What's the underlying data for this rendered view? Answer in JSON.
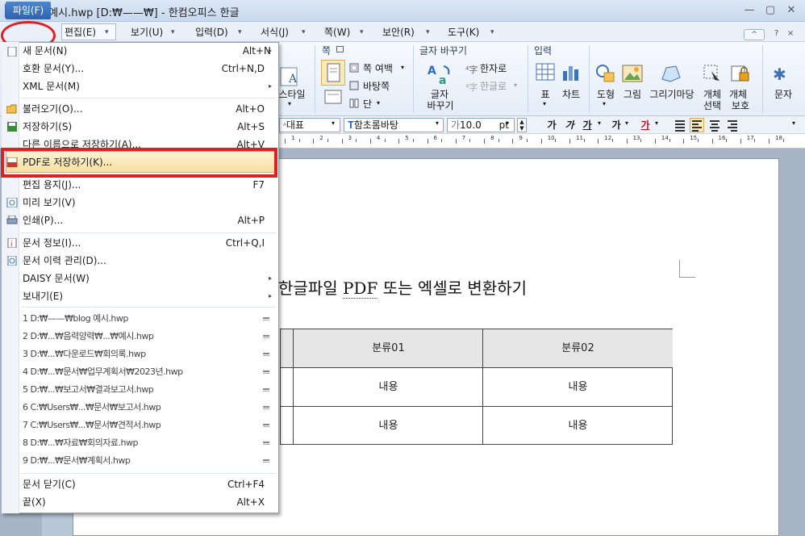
{
  "window": {
    "title": "blog 예시.hwp [D:₩——₩] - 한컴오피스 한글",
    "controls": {
      "minimize": "—",
      "restore": "▢",
      "close": "✕"
    }
  },
  "menubar": {
    "items": [
      "파일(F)",
      "편집(E)",
      "보기(U)",
      "입력(D)",
      "서식(J)",
      "쪽(W)",
      "보안(R)",
      "도구(K)"
    ],
    "help_items": [
      "^",
      "?",
      "×"
    ]
  },
  "ribbon": {
    "groups": {
      "page": "쪽",
      "char_convert": "글자 바꾸기",
      "input": "입력"
    },
    "buttons": {
      "style": "스타일",
      "page_margin": "쪽 여백",
      "background": "바탕쪽",
      "column": "단",
      "change_char": "글자\n바꾸기",
      "change_char_1": "글자",
      "change_char_2": "바꾸기",
      "hanja": "한자로",
      "hangul": "한글로",
      "table": "표",
      "chart": "차트",
      "shape": "도형",
      "picture": "그림",
      "drawing_mart": "그리기마당",
      "object_select_1": "개체",
      "object_select_2": "선택",
      "object_protect_1": "개체",
      "object_protect_2": "보호",
      "char_1": "문자"
    }
  },
  "format_bar": {
    "style": "대표",
    "font": "함초롬바탕",
    "size": "10.0",
    "unit": "pt",
    "bold": "가",
    "italic": "가",
    "underline": "가",
    "char_shape": "가",
    "color_text": "가"
  },
  "ruler": {
    "numbers": [
      "1",
      "2",
      "3",
      "4",
      "5",
      "6",
      "7",
      "8",
      "9",
      "10",
      "11",
      "12",
      "13",
      "14",
      "15",
      "16",
      "17",
      "18"
    ]
  },
  "document": {
    "title_pre": "한글파일 ",
    "title_pdf": "PDF",
    "title_post": " 또는 엑셀로 변환하기",
    "table": {
      "headers": [
        "분류01",
        "분류02"
      ],
      "rows": [
        [
          "내용",
          "내용"
        ],
        [
          "내용",
          "내용"
        ]
      ]
    }
  },
  "file_menu": {
    "items": [
      {
        "label": "새 문서(N)",
        "shortcut": "Alt+N",
        "arrow": "▸"
      },
      {
        "label": "호환 문서(Y)...",
        "shortcut": "Ctrl+N,D",
        "arrow": ""
      },
      {
        "label": "XML 문서(M)",
        "shortcut": "",
        "arrow": "▸"
      },
      {
        "label": "불러오기(O)...",
        "shortcut": "Alt+O",
        "arrow": ""
      },
      {
        "label": "저장하기(S)",
        "shortcut": "Alt+S",
        "arrow": ""
      },
      {
        "label": "다른 이름으로 저장하기(A)...",
        "shortcut": "Alt+V",
        "arrow": ""
      },
      {
        "label": "PDF로 저장하기(K)...",
        "shortcut": "",
        "arrow": ""
      },
      {
        "label": "편집 용지(J)...",
        "shortcut": "F7",
        "arrow": ""
      },
      {
        "label": "미리 보기(V)",
        "shortcut": "",
        "arrow": ""
      },
      {
        "label": "인쇄(P)...",
        "shortcut": "Alt+P",
        "arrow": ""
      },
      {
        "label": "문서 정보(I)...",
        "shortcut": "Ctrl+Q,I",
        "arrow": ""
      },
      {
        "label": "문서 이력 관리(D)...",
        "shortcut": "",
        "arrow": ""
      },
      {
        "label": "DAISY 문서(W)",
        "shortcut": "",
        "arrow": "▸"
      },
      {
        "label": "보내기(E)",
        "shortcut": "",
        "arrow": "▸"
      },
      {
        "label": "문서 닫기(C)",
        "shortcut": "Ctrl+F4",
        "arrow": ""
      },
      {
        "label": "끝(X)",
        "shortcut": "Alt+X",
        "arrow": ""
      }
    ],
    "recent_files": [
      "1 D:₩——₩blog 예시.hwp",
      "2 D:₩...₩음력양력₩...₩예시.hwp",
      "3 D:₩...₩다운로드₩회의록.hwp",
      "4 D:₩...₩문서₩업무계획서₩2023년.hwp",
      "5 D:₩...₩보고서₩결과보고서.hwp",
      "6 C:₩Users₩...₩문서₩보고서.hwp",
      "7 C:₩Users₩...₩문서₩견적서.hwp",
      "8 D:₩...₩자료₩회의자료.hwp",
      "9 D:₩...₩문서₩계획서.hwp"
    ]
  }
}
